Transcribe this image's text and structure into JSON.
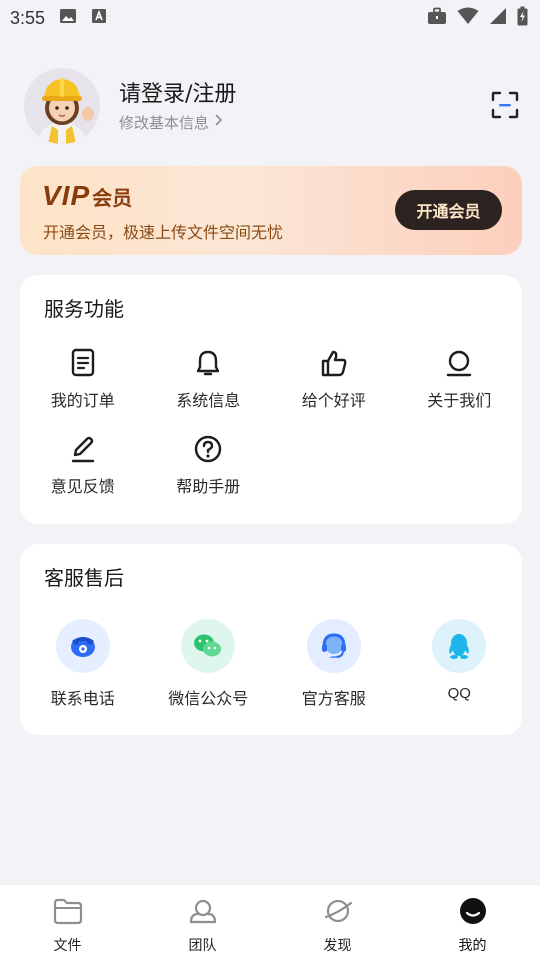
{
  "status_bar": {
    "time": "3:55"
  },
  "profile": {
    "title": "请登录/注册",
    "subtitle": "修改基本信息"
  },
  "vip": {
    "logo_text": "VIP",
    "badge_text": "会员",
    "description": "开通会员，极速上传文件空间无忧",
    "button_label": "开通会员"
  },
  "services": {
    "title": "服务功能",
    "items": [
      {
        "label": "我的订单",
        "icon": "order-icon"
      },
      {
        "label": "系统信息",
        "icon": "bell-icon"
      },
      {
        "label": "给个好评",
        "icon": "thumbs-up-icon"
      },
      {
        "label": "关于我们",
        "icon": "about-icon"
      },
      {
        "label": "意见反馈",
        "icon": "edit-icon"
      },
      {
        "label": "帮助手册",
        "icon": "help-icon"
      }
    ]
  },
  "support": {
    "title": "客服售后",
    "items": [
      {
        "label": "联系电话",
        "icon": "phone-icon"
      },
      {
        "label": "微信公众号",
        "icon": "wechat-icon"
      },
      {
        "label": "官方客服",
        "icon": "headset-icon"
      },
      {
        "label": "QQ",
        "icon": "qq-icon"
      }
    ]
  },
  "bottom_nav": {
    "items": [
      {
        "label": "文件",
        "icon": "folder-icon"
      },
      {
        "label": "团队",
        "icon": "team-icon"
      },
      {
        "label": "发现",
        "icon": "discover-icon"
      },
      {
        "label": "我的",
        "icon": "me-icon",
        "active": true
      }
    ]
  }
}
